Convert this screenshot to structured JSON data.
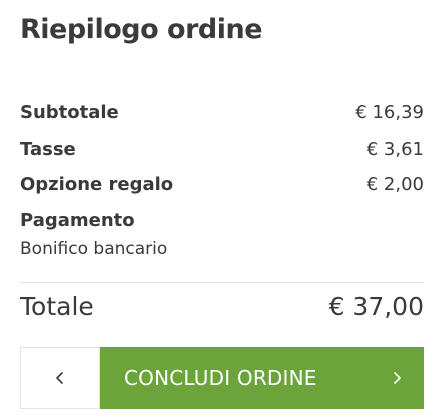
{
  "title": "Riepilogo ordine",
  "summary": {
    "subtotal_label": "Subtotale",
    "subtotal_value": "€ 16,39",
    "tax_label": "Tasse",
    "tax_value": "€ 3,61",
    "gift_label": "Opzione regalo",
    "gift_value": "€ 2,00",
    "payment_label": "Pagamento",
    "payment_method": "Bonifico bancario",
    "total_label": "Totale",
    "total_value": "€ 37,00"
  },
  "actions": {
    "back_icon": "chevron-left-icon",
    "confirm_label": "CONCLUDI ORDINE",
    "confirm_icon": "chevron-right-icon"
  },
  "colors": {
    "accent": "#6aa43a",
    "text": "#3a3a3a",
    "divider": "#e6e6e6"
  }
}
